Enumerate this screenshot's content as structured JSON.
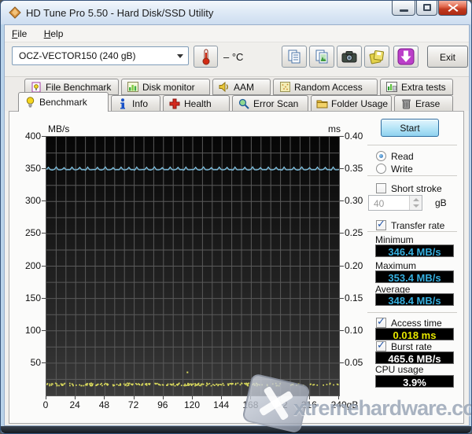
{
  "window": {
    "title": "HD Tune Pro 5.50 - Hard Disk/SSD Utility"
  },
  "menu": {
    "items": [
      "File",
      "Help"
    ]
  },
  "toolbar": {
    "drive_select_value": "OCZ-VECTOR150 (240 gB)",
    "temperature_display": "– °C",
    "icons": [
      "thermometer-icon",
      "copy-text-icon",
      "copy-image-icon",
      "camera-icon",
      "save-icon",
      "download-icon"
    ],
    "exit_label": "Exit"
  },
  "tabs": {
    "active": "Benchmark",
    "row1": [
      {
        "label": "File Benchmark",
        "icon": "file-benchmark-icon"
      },
      {
        "label": "Disk monitor",
        "icon": "disk-monitor-icon"
      },
      {
        "label": "AAM",
        "icon": "speaker-icon"
      },
      {
        "label": "Random Access",
        "icon": "random-access-icon"
      },
      {
        "label": "Extra tests",
        "icon": "extra-tests-icon"
      }
    ],
    "row2": [
      {
        "label": "Benchmark",
        "icon": "lightbulb-icon"
      },
      {
        "label": "Info",
        "icon": "info-icon"
      },
      {
        "label": "Health",
        "icon": "health-cross-icon"
      },
      {
        "label": "Error Scan",
        "icon": "magnifier-icon"
      },
      {
        "label": "Folder Usage",
        "icon": "folder-icon"
      },
      {
        "label": "Erase",
        "icon": "trash-icon"
      }
    ]
  },
  "controls": {
    "start_label": "Start",
    "read_label": "Read",
    "read_checked": true,
    "write_label": "Write",
    "write_checked": false,
    "short_stroke_label": "Short stroke",
    "short_stroke_checked": false,
    "short_stroke_value": "40",
    "short_stroke_unit": "gB",
    "transfer_rate_label": "Transfer rate",
    "transfer_rate_checked": true,
    "minimum_label": "Minimum",
    "minimum_value": "346.4 MB/s",
    "maximum_label": "Maximum",
    "maximum_value": "353.4 MB/s",
    "average_label": "Average",
    "average_value": "348.4 MB/s",
    "access_time_label": "Access time",
    "access_time_checked": true,
    "access_time_value": "0.018 ms",
    "burst_rate_label": "Burst rate",
    "burst_rate_checked": true,
    "burst_rate_value": "465.6 MB/s",
    "cpu_usage_label": "CPU usage",
    "cpu_usage_value": "3.9%"
  },
  "chart_data": {
    "type": "line",
    "title": "",
    "x_axis": {
      "unit": "gB",
      "min": 0,
      "max": 240,
      "tick_labels": [
        "0",
        "24",
        "48",
        "72",
        "96",
        "120",
        "144",
        "168",
        "192",
        "216",
        "240gB"
      ]
    },
    "y_left_axis": {
      "label": "MB/s",
      "min": 0,
      "max": 400,
      "tick_labels": [
        "400",
        "350",
        "300",
        "250",
        "200",
        "150",
        "100",
        "50"
      ]
    },
    "y_right_axis": {
      "label": "ms",
      "min": 0,
      "max": 0.4,
      "tick_labels": [
        "0.40",
        "0.35",
        "0.30",
        "0.25",
        "0.20",
        "0.15",
        "0.10",
        "0.05"
      ]
    },
    "grid": {
      "x_step_gb": 8,
      "y_step_mbps": 25,
      "color": "#5a5a5a"
    },
    "series": [
      {
        "name": "Transfer rate",
        "style": "line",
        "color": "#7cc0e0",
        "unit": "MB/s",
        "min": 346.4,
        "max": 353.4,
        "avg": 348.4,
        "points": 150,
        "pattern_mbps": [
          349.2,
          352.8,
          349.0,
          348.6,
          349.4,
          353.4,
          349.1,
          348.8,
          349.5,
          352.4,
          348.9,
          349.3,
          349.0,
          353.1,
          349.2,
          348.8,
          349.6,
          352.7,
          349.0,
          349.3,
          348.5,
          353.2,
          349.1,
          348.9,
          349.4
        ]
      },
      {
        "name": "Access time",
        "style": "dots",
        "color": "#d9d95c",
        "unit": "ms",
        "value_ms": 0.018,
        "jitter_ms": 0.004,
        "count": 300,
        "outliers": [
          {
            "x_gb": 115,
            "y_ms": 0.037
          }
        ]
      }
    ]
  },
  "watermark": {
    "text": "xtremehardware.com",
    "logo": "x-tile-logo"
  }
}
